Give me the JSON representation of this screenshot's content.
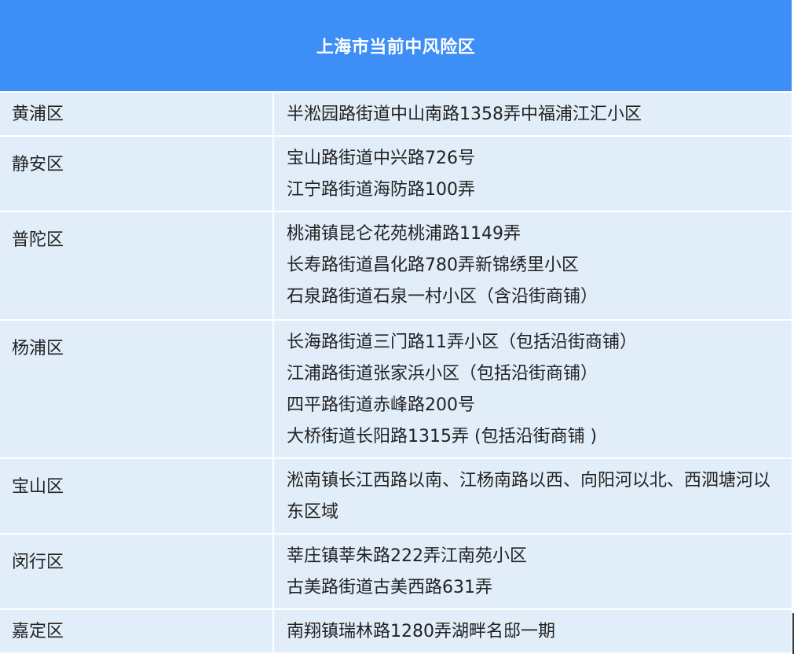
{
  "title": "上海市当前中风险区",
  "rows": [
    {
      "district": "黄浦区",
      "addresses": [
        "半淞园路街道中山南路1358弄中福浦江汇小区"
      ]
    },
    {
      "district": "静安区",
      "addresses": [
        "宝山路街道中兴路726号",
        "江宁路街道海防路100弄"
      ]
    },
    {
      "district": "普陀区",
      "addresses": [
        "桃浦镇昆仑花苑桃浦路1149弄",
        "长寿路街道昌化路780弄新锦绣里小区",
        "石泉路街道石泉一村小区（含沿街商铺）"
      ]
    },
    {
      "district": "杨浦区",
      "addresses": [
        "长海路街道三门路11弄小区（包括沿街商铺）",
        "江浦路街道张家浜小区（包括沿街商铺）",
        "四平路街道赤峰路200号",
        "大桥街道长阳路1315弄 (包括沿街商铺 )"
      ]
    },
    {
      "district": "宝山区",
      "addresses": [
        "淞南镇长江西路以南、江杨南路以西、向阳河以北、西泗塘河以东区域"
      ]
    },
    {
      "district": "闵行区",
      "addresses": [
        "莘庄镇莘朱路222弄江南苑小区",
        "古美路街道古美西路631弄"
      ]
    },
    {
      "district": "嘉定区",
      "addresses": [
        "南翔镇瑞林路1280弄湖畔名邸一期"
      ]
    }
  ]
}
